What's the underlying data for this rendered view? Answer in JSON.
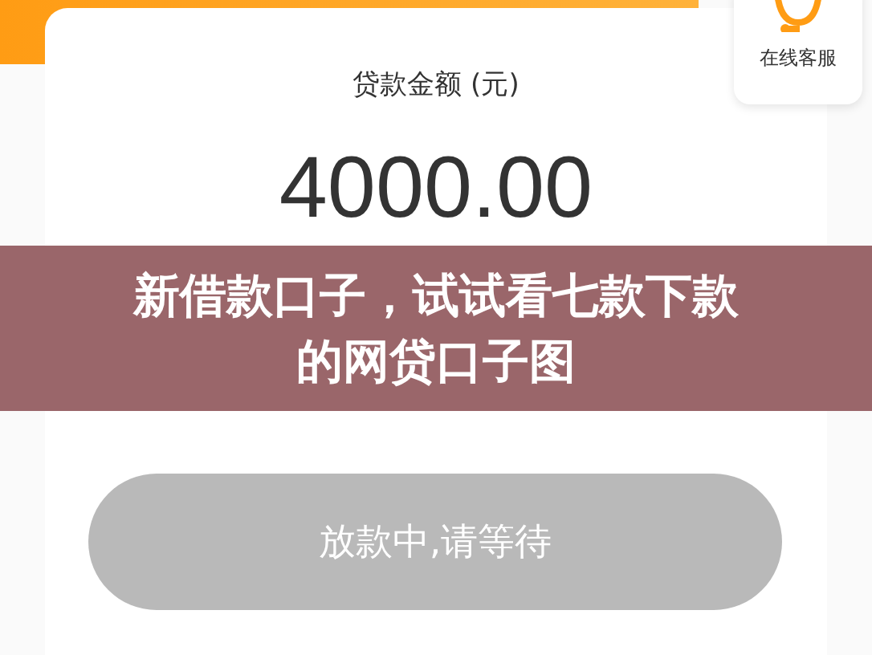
{
  "loan_card": {
    "label": "贷款金额 (元)",
    "amount": "4000.00"
  },
  "service": {
    "label": "在线客服"
  },
  "status_button": {
    "label": "放款中,请等待",
    "disabled": true
  },
  "caption_banner": {
    "lines": [
      "新借款口子，试试看七款下款",
      "的网贷口子图"
    ]
  }
}
